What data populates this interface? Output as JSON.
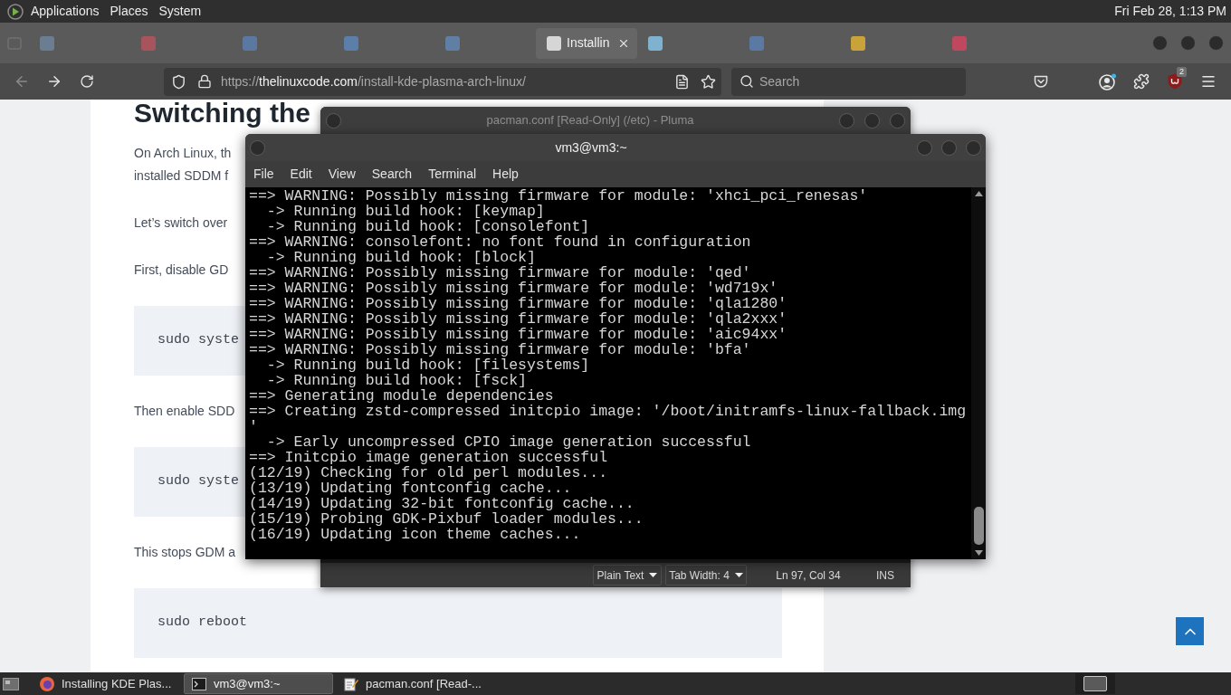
{
  "top_panel": {
    "menus": [
      "Applications",
      "Places",
      "System"
    ],
    "clock": "Fri Feb 28, 1:13 PM"
  },
  "browser": {
    "tabs": [
      {
        "selected": false,
        "color": "#6b7d90"
      },
      {
        "selected": false,
        "color": "#a8545c"
      },
      {
        "selected": false,
        "color": "#5b78a0"
      },
      {
        "selected": false,
        "color": "#5b7fa8"
      },
      {
        "selected": false,
        "color": "#607fa4"
      },
      {
        "selected": true,
        "color": "#d6d6d6",
        "label": "Installin"
      },
      {
        "selected": false,
        "color": "#7fb2cf"
      },
      {
        "selected": false,
        "color": "#5b7aa3"
      },
      {
        "selected": false,
        "color": "#c9a23a"
      },
      {
        "selected": false,
        "color": "#c0485e"
      }
    ],
    "nav": {
      "back": {
        "disabled": true
      },
      "forward": {
        "disabled": false
      },
      "url": {
        "scheme": "https://",
        "domain": "thelinuxcode.com",
        "path": "/install-kde-plasma-arch-linux/"
      },
      "search": {
        "placeholder": "Search"
      },
      "extension_badge": "2"
    },
    "article": {
      "heading": "Switching the",
      "blocks": [
        {
          "kind": "paragraph",
          "lines": [
            "On Arch Linux, th",
            "installed SDDM f"
          ]
        },
        {
          "kind": "paragraph",
          "lines": [
            "Let’s switch over"
          ]
        },
        {
          "kind": "paragraph",
          "lines": [
            "First, disable GD"
          ]
        },
        {
          "kind": "code",
          "text": "sudo syste"
        },
        {
          "kind": "paragraph",
          "lines": [
            "Then enable SDD"
          ]
        },
        {
          "kind": "code",
          "text": "sudo syste"
        },
        {
          "kind": "paragraph",
          "lines": [
            "This stops GDM a"
          ]
        },
        {
          "kind": "code",
          "text": "sudo reboot"
        }
      ]
    }
  },
  "editor_window": {
    "focused": false,
    "title": "pacman.conf [Read-Only] (/etc) - Pluma",
    "status_bar": {
      "language": "Plain Text",
      "tab_width": "Tab Width: 4",
      "position": "Ln 97, Col 34",
      "mode": "INS"
    }
  },
  "terminal_window": {
    "focused": true,
    "title": "vm3@vm3:~",
    "menus": [
      "File",
      "Edit",
      "View",
      "Search",
      "Terminal",
      "Help"
    ],
    "lines": [
      "==> WARNING: Possibly missing firmware for module: 'xhci_pci_renesas'",
      "  -> Running build hook: [keymap]",
      "  -> Running build hook: [consolefont]",
      "==> WARNING: consolefont: no font found in configuration",
      "  -> Running build hook: [block]",
      "==> WARNING: Possibly missing firmware for module: 'qed'",
      "==> WARNING: Possibly missing firmware for module: 'wd719x'",
      "==> WARNING: Possibly missing firmware for module: 'qla1280'",
      "==> WARNING: Possibly missing firmware for module: 'qla2xxx'",
      "==> WARNING: Possibly missing firmware for module: 'aic94xx'",
      "==> WARNING: Possibly missing firmware for module: 'bfa'",
      "  -> Running build hook: [filesystems]",
      "  -> Running build hook: [fsck]",
      "==> Generating module dependencies",
      "==> Creating zstd-compressed initcpio image: '/boot/initramfs-linux-fallback.img",
      "'",
      "  -> Early uncompressed CPIO image generation successful",
      "==> Initcpio image generation successful",
      "(12/19) Checking for old perl modules...",
      "(13/19) Updating fontconfig cache...",
      "(14/19) Updating 32-bit fontconfig cache...",
      "(15/19) Probing GDK-Pixbuf loader modules...",
      "(16/19) Updating icon theme caches..."
    ]
  },
  "taskbar": {
    "items": [
      {
        "kind": "browser",
        "label": "Installing KDE Plas...",
        "selected": false
      },
      {
        "kind": "terminal",
        "label": "vm3@vm3:~",
        "selected": true
      },
      {
        "kind": "editor",
        "label": "pacman.conf [Read-...",
        "selected": false
      }
    ]
  }
}
